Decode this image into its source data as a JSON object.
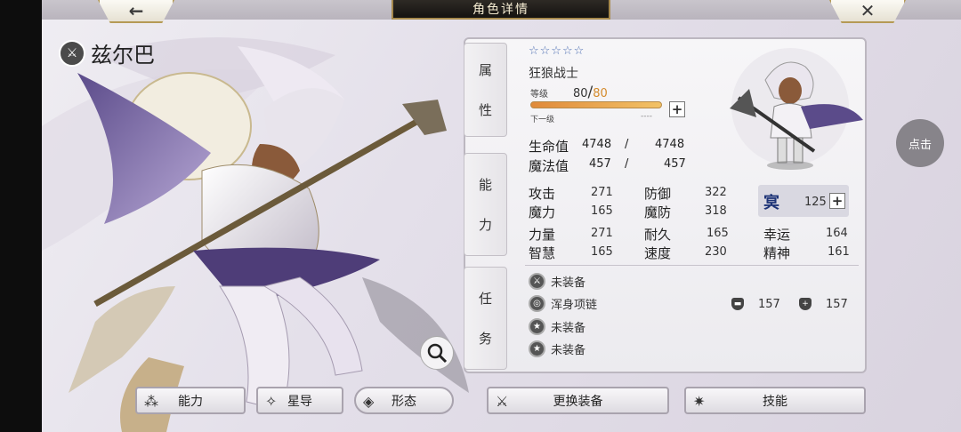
{
  "header": {
    "title": "角色详情",
    "back_icon": "←",
    "close_icon": "✕"
  },
  "character": {
    "name": "兹尔巴",
    "stars": "☆☆☆☆☆",
    "class": "狂狼战士"
  },
  "tabs": {
    "attr": [
      "属",
      "性"
    ],
    "ability": [
      "能",
      "力"
    ],
    "quest": [
      "任",
      "务"
    ]
  },
  "level": {
    "label": "等级",
    "current": "80",
    "slash": "/",
    "max": "80",
    "next_label": "下一级",
    "next_value": "----",
    "exp_fraction": 1.0
  },
  "vitals": [
    {
      "label": "生命值",
      "cur": "4748",
      "sep": "/",
      "max": "4748"
    },
    {
      "label": "魔法值",
      "cur": "457",
      "sep": "/",
      "max": "457"
    }
  ],
  "stats": [
    {
      "label": "攻击",
      "value": "271"
    },
    {
      "label": "防御",
      "value": "322"
    },
    {
      "label": "魔力",
      "value": "165"
    },
    {
      "label": "魔防",
      "value": "318"
    },
    {
      "label": "力量",
      "value": "271"
    },
    {
      "label": "耐久",
      "value": "165"
    },
    {
      "label": "幸运",
      "value": "164"
    },
    {
      "label": "智慧",
      "value": "165"
    },
    {
      "label": "速度",
      "value": "230"
    },
    {
      "label": "精神",
      "value": "161"
    }
  ],
  "rune": {
    "value": "125"
  },
  "equipment": [
    {
      "label": "未装备",
      "icon": "weapon-icon"
    },
    {
      "label": "浑身项链",
      "icon": "necklace-icon",
      "def1": "157",
      "def2": "157"
    },
    {
      "label": "未装备",
      "icon": "accessory-icon"
    },
    {
      "label": "未装备",
      "icon": "accessory-icon"
    }
  ],
  "buttons": {
    "ability": "能力",
    "star_guide": "星导",
    "form": "形态",
    "change_equip": "更换装备",
    "skills": "技能",
    "click": "点击"
  },
  "colors": {
    "accent_gold": "#b59a55",
    "level_max": "#d48a2a",
    "stars": "#4d6fb3"
  }
}
